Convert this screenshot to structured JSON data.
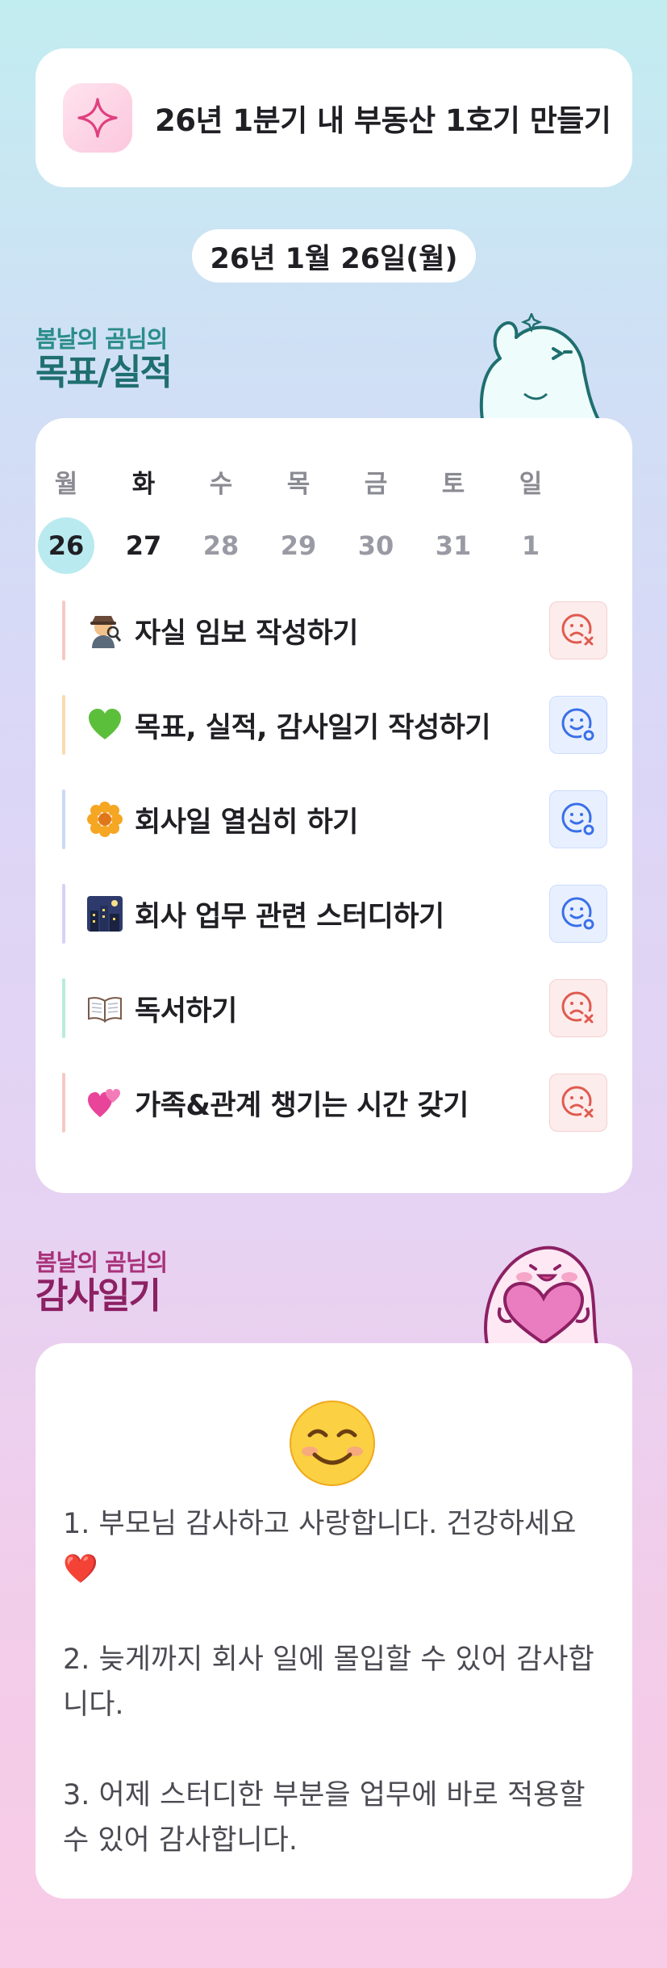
{
  "goal": {
    "title": "26년 1분기 내 부동산 1호기 만들기",
    "icon": "sparkle-icon"
  },
  "date": "26년 1월 26일(월)",
  "goals_section": {
    "subtitle": "봄날의 곰님의",
    "title": "목표/실적"
  },
  "week": {
    "days": [
      "월",
      "화",
      "수",
      "목",
      "금",
      "토",
      "일"
    ],
    "dates": [
      "26",
      "27",
      "28",
      "29",
      "30",
      "31",
      "1"
    ],
    "selected_index": 0
  },
  "todos": [
    {
      "emoji": "🕵",
      "label": "자실 임보 작성하기",
      "status": "fail",
      "bar_color": "#f6c9c4"
    },
    {
      "emoji": "💚",
      "label": "목표, 실적, 감사일기 작성하기",
      "status": "done",
      "bar_color": "#f9dcae"
    },
    {
      "emoji": "🌼",
      "label": "회사일 열심히 하기",
      "status": "done",
      "bar_color": "#cad9f6"
    },
    {
      "emoji": "🌃",
      "label": "회사 업무 관련 스터디하기",
      "status": "done",
      "bar_color": "#d9d0f6"
    },
    {
      "emoji": "📖",
      "label": "독서하기",
      "status": "fail",
      "bar_color": "#b8ecd9"
    },
    {
      "emoji": "💕",
      "label": "가족&관계 챙기는 시간 갖기",
      "status": "fail",
      "bar_color": "#f6c9c4"
    }
  ],
  "thanks_section": {
    "subtitle": "봄날의 곰님의",
    "title": "감사일기"
  },
  "thanks": {
    "emoji": "smiling-face-icon",
    "entries": [
      "1. 부모님 감사하고 사랑합니다. 건강하세요❤️",
      "2. 늦게까지 회사 일에 몰입할 수 있어 감사합니다.",
      "3. 어제 스터디한 부분을 업무에 바로 적용할 수 있어 감사합니다."
    ]
  }
}
